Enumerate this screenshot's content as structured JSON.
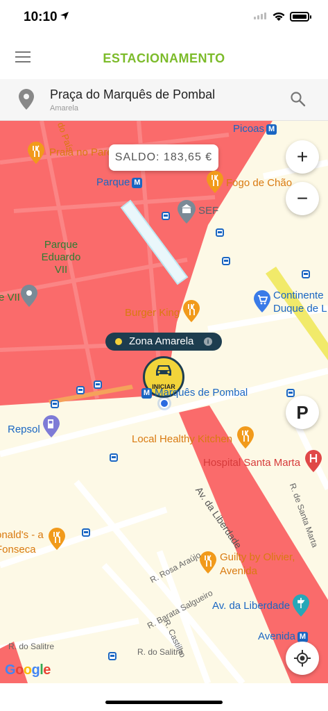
{
  "status_bar": {
    "time": "10:10"
  },
  "header": {
    "title": "ESTACIONAMENTO"
  },
  "search": {
    "title": "Praça do Marquês de Pombal",
    "subtitle": "Amarela"
  },
  "map": {
    "saldo_label": "SALDO: 183,65 €",
    "zoom_in": "+",
    "zoom_out": "−",
    "parking": "P",
    "zone_label": "Zona Amarela",
    "zone_info": "i",
    "start_label": "INICIAR",
    "places": {
      "picoas": "Picoas",
      "praia_no_parque": "Praia no Parque",
      "parque": "Parque",
      "fogo_de_chao": "Fogo de Chão",
      "sef": "SEF",
      "parque_eduardo": "Parque Eduardo VII",
      "eduardo_vii": "e VII",
      "burger_king": "Burger King",
      "continente": "Continente Duque de L",
      "marques_de_pombal": "Marquês de Pombal",
      "repsol": "Repsol",
      "local_healthy": "Local Healthy Kitchen",
      "hospital": "Hospital Santa Marta",
      "mcdonalds": "onald's - a Fonseca",
      "guilty": "Guilty by Olivier, Avenida",
      "av_liberdade": "Av. da Liberdade",
      "av_liberdade_poi": "Av. da Liberdade",
      "avenida": "Avenida",
      "de_pais": "do País",
      "r_santa_marta": "R. de Santa Marta",
      "r_rosa_araujo": "R. Rosa Araújo",
      "r_barata_salgueiro": "R. Barata Salgueiro",
      "r_castilho": "R. Castilho",
      "r_do_salitre_1": "R. do Salitre",
      "r_do_salitre_2": "R. do Salitre"
    },
    "google": "Google"
  },
  "colors": {
    "accent": "#7cbb2a",
    "zone_red": "#fa6b6b",
    "zone_label_bg": "#1d3d4f",
    "start_button": "#f2d43a"
  },
  "icons": [
    "menu-icon",
    "location-pin-icon",
    "search-icon",
    "plus-icon",
    "minus-icon",
    "parking-icon",
    "my-location-icon",
    "car-icon",
    "info-icon",
    "restaurant-icon",
    "metro-icon",
    "bus-icon",
    "hospital-icon",
    "cart-icon",
    "gas-icon",
    "museum-icon"
  ]
}
